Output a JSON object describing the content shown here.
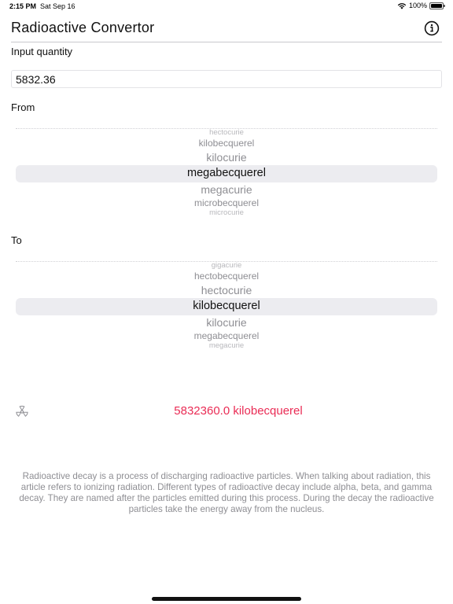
{
  "status_bar": {
    "time": "2:15 PM",
    "date": "Sat Sep 16",
    "battery": "100%"
  },
  "app": {
    "title": "Radioactive Convertor"
  },
  "input": {
    "label": "Input quantity",
    "value": "5832.36"
  },
  "from_picker": {
    "label": "From",
    "items": [
      "hectocurie",
      "kilobecquerel",
      "kilocurie",
      "megabecquerel",
      "megacurie",
      "microbecquerel",
      "microcurie"
    ],
    "selected": "megabecquerel"
  },
  "to_picker": {
    "label": "To",
    "items": [
      "gigacurie",
      "hectobecquerel",
      "hectocurie",
      "kilobecquerel",
      "kilocurie",
      "megabecquerel",
      "megacurie"
    ],
    "selected": "kilobecquerel"
  },
  "result": {
    "text": "5832360.0 kilobecquerel",
    "color": "#ea2c55"
  },
  "description": "Radioactive decay is a process of discharging radioactive particles. When talking about radiation, this article refers to ionizing radiation. Different types of radioactive decay include alpha, beta, and gamma decay. They are named after the particles emitted during this process. During the decay the radioactive particles take the energy away from the nucleus.",
  "icons": {
    "info": "info-icon",
    "radiation": "radiation-icon",
    "wifi": "wifi-icon",
    "battery": "battery-icon"
  }
}
